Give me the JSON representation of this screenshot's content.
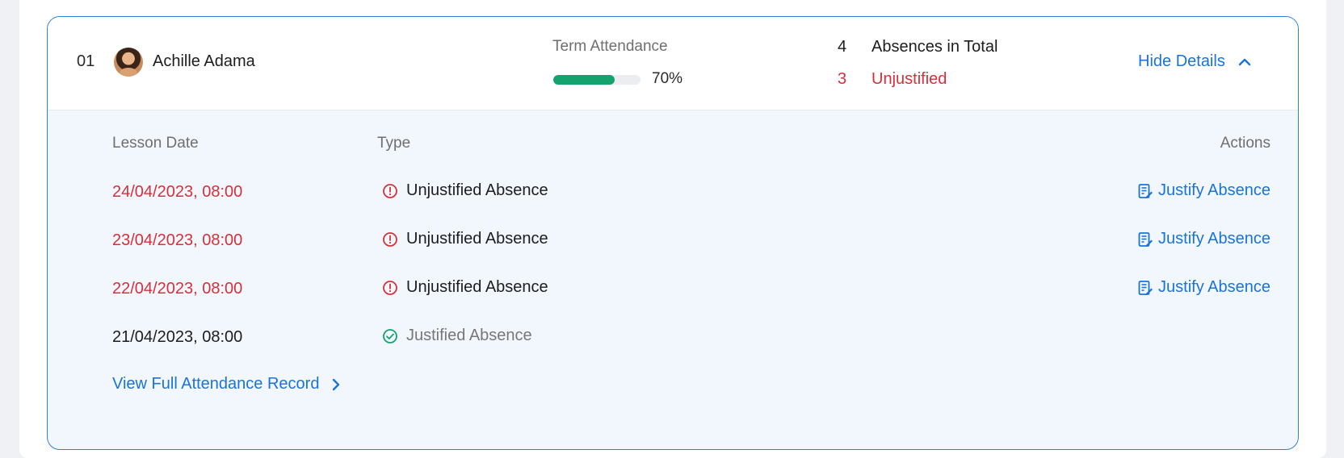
{
  "student": {
    "index": "01",
    "name": "Achille Adama"
  },
  "attendance": {
    "label": "Term Attendance",
    "percent": 70,
    "percent_label": "70%"
  },
  "absences": {
    "total_count": "4",
    "total_label": "Absences in Total",
    "unjustified_count": "3",
    "unjustified_label": "Unjustified"
  },
  "toggle": {
    "label": "Hide Details",
    "icon": "chevron-up-icon"
  },
  "table": {
    "headers": {
      "date": "Lesson Date",
      "type": "Type",
      "actions": "Actions"
    },
    "rows": [
      {
        "date": "24/04/2023, 08:00",
        "type": "Unjustified Absence",
        "status": "unjustified",
        "action": "Justify Absence"
      },
      {
        "date": "23/04/2023, 08:00",
        "type": "Unjustified Absence",
        "status": "unjustified",
        "action": "Justify Absence"
      },
      {
        "date": "22/04/2023, 08:00",
        "type": "Unjustified Absence",
        "status": "unjustified",
        "action": "Justify Absence"
      },
      {
        "date": "21/04/2023, 08:00",
        "type": "Justified Absence",
        "status": "justified",
        "action": ""
      }
    ]
  },
  "footer_link": {
    "label": "View Full Attendance Record",
    "icon": "chevron-right-icon"
  },
  "colors": {
    "accent": "#1a73d9",
    "danger": "#d6303a",
    "success": "#14a26f",
    "border": "#2f80d9"
  }
}
